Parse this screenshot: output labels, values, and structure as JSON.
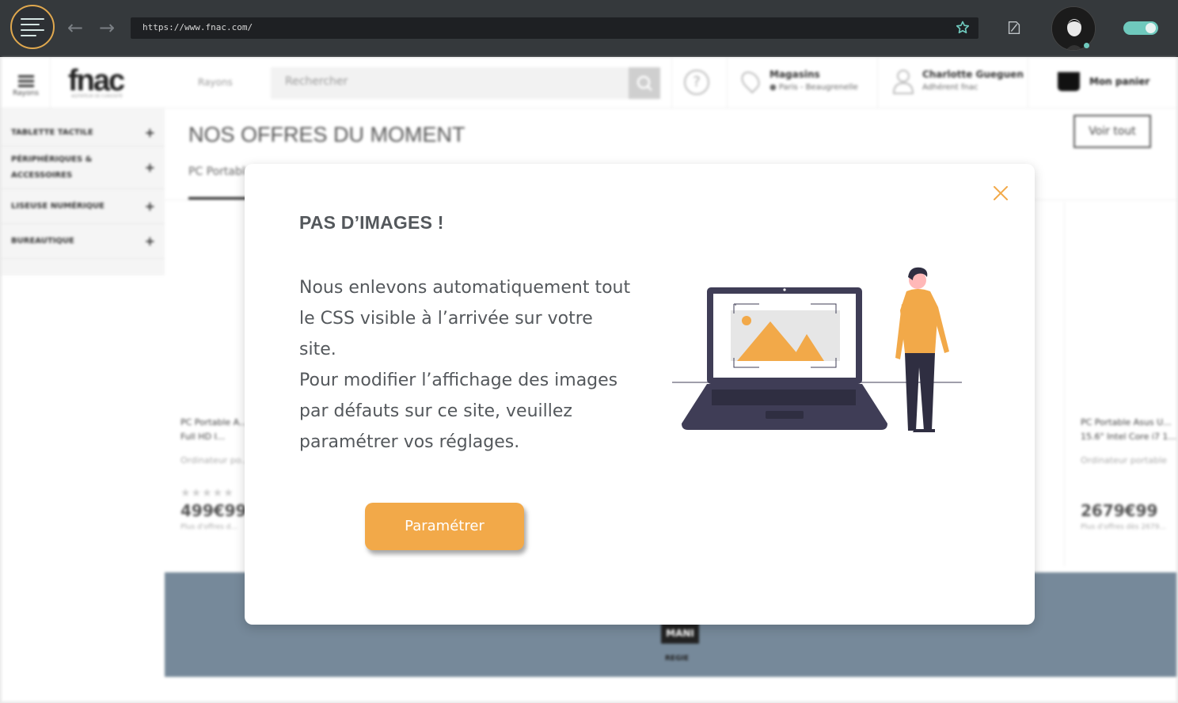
{
  "browser": {
    "url": "https://www.fnac.com/"
  },
  "site": {
    "header": {
      "rayons_label": "Rayons",
      "logo": "fnac",
      "logo_sub": "AGITATEUR DE CURIOSITÉ",
      "category_select": "Rayons",
      "search_placeholder": "Rechercher",
      "stores_title": "Magasins",
      "stores_sub": "● Paris - Beaugrenelle",
      "user_name": "Charlotte Gueguen",
      "user_sub": "Adhérent fnac",
      "cart_label": "Mon panier"
    },
    "sidebar": {
      "items": [
        {
          "label": "TABLETTE TACTILE"
        },
        {
          "label": "PÉRIPHÉRIQUES & ACCESSOIRES"
        },
        {
          "label": "LISEUSE NUMÉRIQUE"
        },
        {
          "label": "BUREAUTIQUE"
        }
      ]
    },
    "main": {
      "title": "NOS OFFRES DU MOMENT",
      "see_all": "Voir tout",
      "tab": "PC Portable",
      "cards": [
        {
          "name": "PC Portable A... 15,6\" Full HD I...",
          "desc": "Ordinateur po...",
          "stars": "★★★★★",
          "price": "499€99",
          "offers": "Plus d'offres d..."
        },
        {
          "name": "PC Portable Asus U... 15.6\" Intel Core i7 1...",
          "desc": "Ordinateur portable",
          "stars": "",
          "price": "2679€99",
          "offers": "Plus d'offres dès 2679..."
        }
      ]
    },
    "banner": {
      "logo": "MANI",
      "caption": "REGIE"
    }
  },
  "modal": {
    "title": "PAS D’IMAGES !",
    "paragraph1": "Nous enlevons automatiquement tout le CSS visible à l’arrivée sur votre site.",
    "paragraph2": "Pour modifier l’affichage des images par défauts sur ce site, veuillez paramétrer vos réglages.",
    "button_label": "Paramétrer",
    "accent_color": "#f2a949"
  }
}
